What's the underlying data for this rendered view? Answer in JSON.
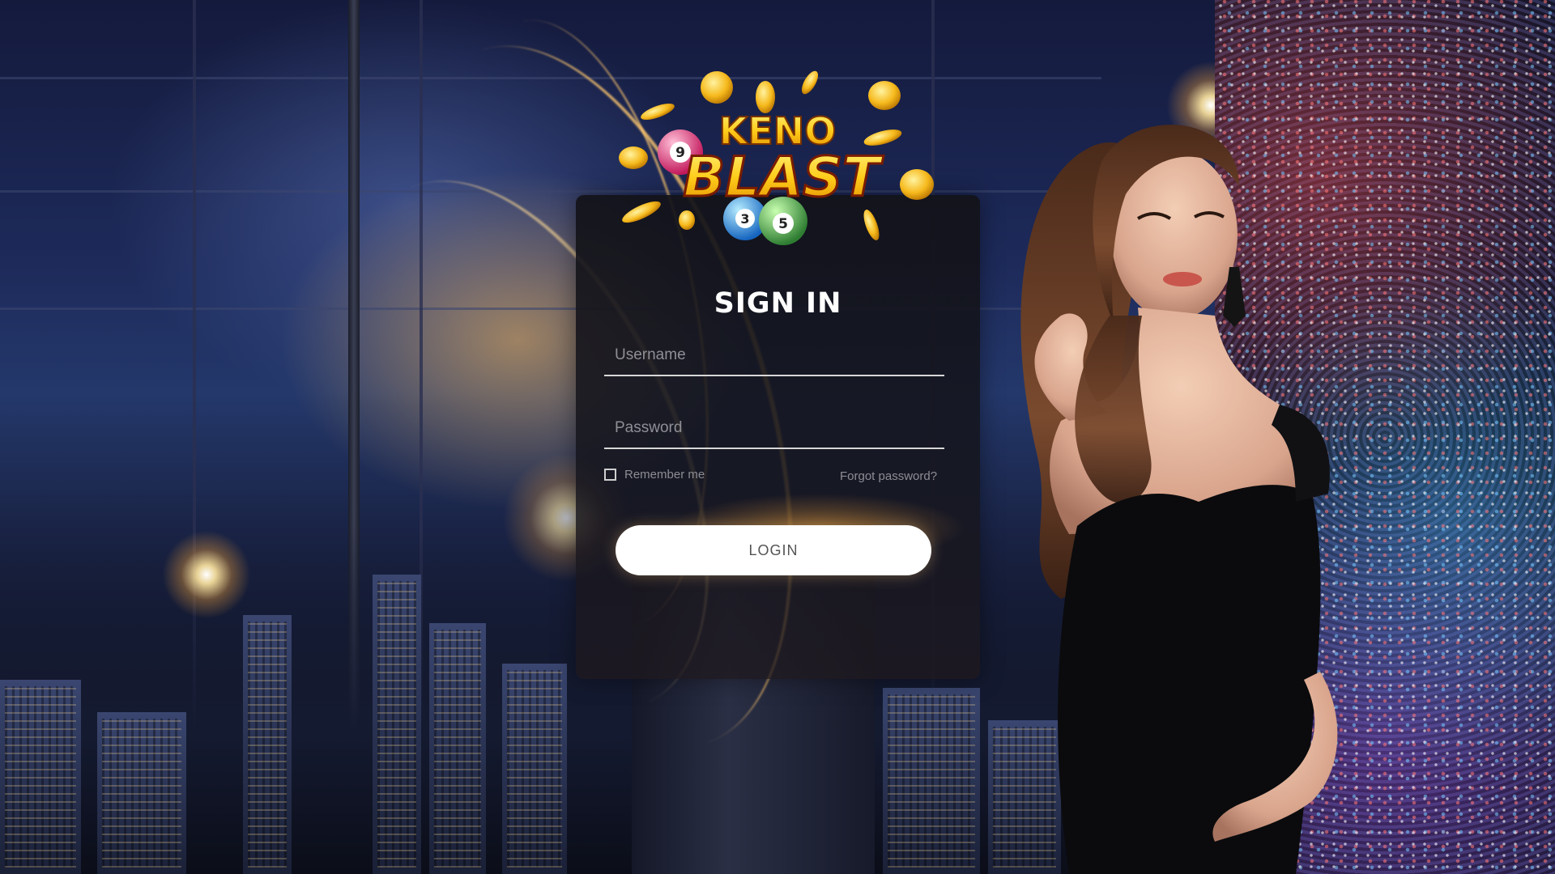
{
  "logo": {
    "line1": "KENO",
    "line2": "BLAST",
    "ball_numbers": [
      "9",
      "3",
      "5"
    ]
  },
  "login_form": {
    "title": "SIGN IN",
    "username_placeholder": "Username",
    "password_placeholder": "Password",
    "remember_label": "Remember me",
    "remember_checked": false,
    "forgot_label": "Forgot password?",
    "login_label": "LOGIN"
  },
  "colors": {
    "panel_background": "#15151c",
    "logo_gold": "#ffcc1a",
    "button_background": "#ffffff",
    "button_text": "#555555",
    "placeholder_text": "#8f8f96"
  }
}
